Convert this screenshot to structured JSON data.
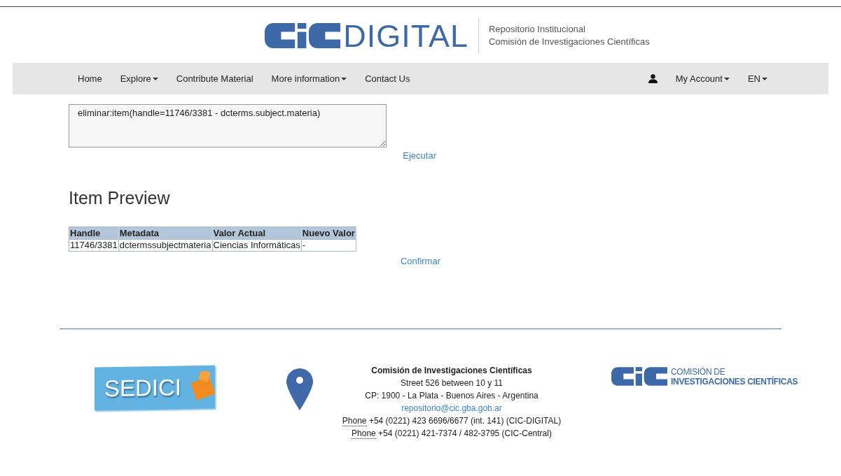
{
  "header": {
    "logo_text": "DIGITAL",
    "subtitle_lines": [
      "Repositorio Institucional",
      "Comisión de Investigaciones Científicas"
    ]
  },
  "nav": {
    "left": [
      {
        "label": "Home",
        "has_menu": false
      },
      {
        "label": "Explore",
        "has_menu": true
      },
      {
        "label": "Contribute Material",
        "has_menu": false
      },
      {
        "label": "More information",
        "has_menu": true
      },
      {
        "label": "Contact Us",
        "has_menu": false
      }
    ],
    "right": [
      {
        "label": "My Account",
        "has_menu": true,
        "kind": "account"
      },
      {
        "label": "EN",
        "has_menu": true,
        "kind": "language"
      }
    ]
  },
  "command": {
    "value": "eliminar:item(handle=11746/3381 - dcterms.subject.materia)",
    "run_link": "Ejecutar"
  },
  "preview": {
    "heading": "Item Preview",
    "columns": [
      "Handle",
      "Metadata",
      "Valor Actual",
      "Nuevo Valor"
    ],
    "rows": [
      [
        "11746/3381",
        "dctermssubjectmateria",
        "Ciencias Informáticas",
        "-"
      ]
    ],
    "confirm_link": "Confirmar"
  },
  "footer": {
    "left_logo_text": "SEDICI",
    "org": "Comisión de Investigaciones Científicas",
    "address_lines": [
      "Street 526 between 10 y 11",
      "CP: 1900 - La Plata - Buenos Aires - Argentina"
    ],
    "email": "repositorio@cic.gba.gob.ar",
    "phones": [
      {
        "label": "Phone",
        "number": "+54 (0221) 423 6696/6677 (int. 141) (CIC-DIGITAL)"
      },
      {
        "label": "Phone",
        "number": "+54 (0221) 421-7374 / 482-3795 (CIC-Central)"
      }
    ],
    "right_logo_lines": [
      "COMISIÓN DE",
      "INVESTIGACIONES CIENTÍFICAS"
    ]
  }
}
